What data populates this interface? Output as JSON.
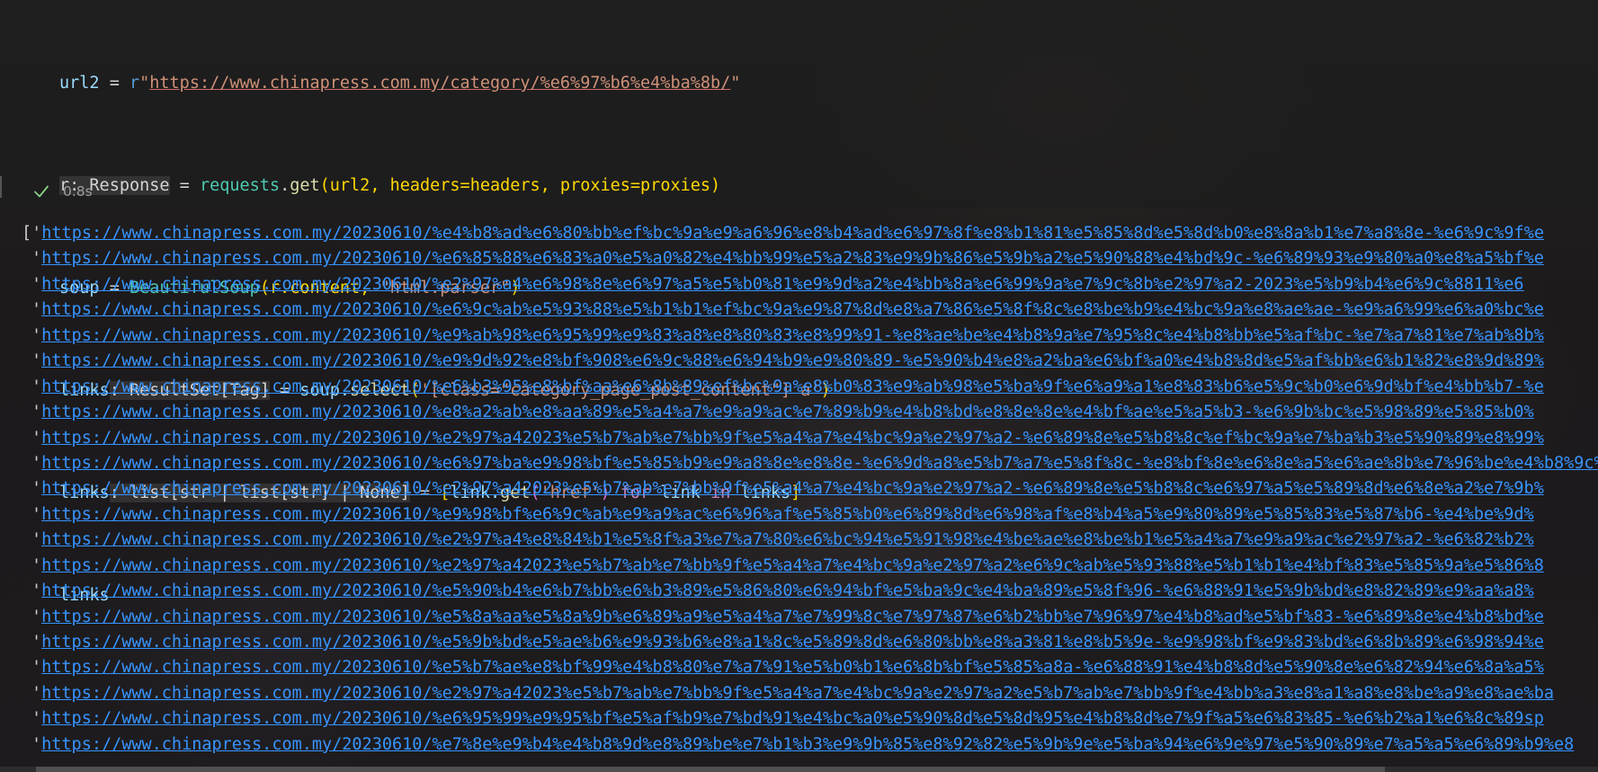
{
  "code_cell": {
    "lines": {
      "l1": {
        "var": "url2",
        "eq": " = ",
        "prefix": "r",
        "q1": "\"",
        "url": "https://www.chinapress.com.my/category/%e6%97%b6%e4%ba%8b/",
        "q2": "\""
      },
      "l2": {
        "hint": "r: Response",
        "eq": " = ",
        "mod": "requests",
        "dot": ".",
        "fn": "get",
        "args": "(url2, headers=headers, proxies=proxies)"
      },
      "l3": {
        "var": "soup",
        "eq": " = ",
        "cls": "BeautifulSoup",
        "open": "(r.content, ",
        "str": "\"html.parser\"",
        "close": ")"
      },
      "l4": {
        "var": "links",
        "hint": ": ResultSet[Tag]",
        "eq": " = ",
        "obj": "soup.",
        "fn": "select",
        "open": "(",
        "str": "'[class=\"category_page_post_content\"] a'",
        "close": ")"
      },
      "l5": {
        "var": "links",
        "hint": ": list[str | list[str] | None]",
        "eq": " = ",
        "lb": "[",
        "expr1": "link.",
        "fn": "get",
        "str_open": "(",
        "str": "'href'",
        "str_close": ")",
        "for_kw": " for ",
        "mid": "link",
        "in_kw": " in ",
        "end": "links",
        "rb": "]"
      },
      "l6": {
        "var": "links"
      }
    }
  },
  "status": {
    "duration": "0.8s"
  },
  "output": {
    "open_bracket": "[",
    "quote": "'",
    "links": [
      "https://www.chinapress.com.my/20230610/%e4%b8%ad%e6%80%bb%ef%bc%9a%e9%a6%96%e8%b4%ad%e6%97%8f%e8%b1%81%e5%85%8d%e5%8d%b0%e8%8a%b1%e7%a8%8e-%e6%9c%9f%e",
      "https://www.chinapress.com.my/20230610/%e6%85%88%e6%83%a0%e5%a0%82%e4%bb%99%e5%a2%83%e9%9b%86%e5%9b%a2%e5%90%88%e4%bd%9c-%e6%89%93%e9%80%a0%e8%a5%bf%e",
      "https://www.chinapress.com.my/20230610/%e2%97%a4%e6%98%8e%e6%97%a5%e5%b0%81%e9%9d%a2%e4%bb%8a%e6%99%9a%e7%9c%8b%e2%97%a2-2023%e5%b9%b4%e6%9c%8811%e6",
      "https://www.chinapress.com.my/20230610/%e6%9c%ab%e5%93%88%e5%b1%b1%ef%bc%9a%e9%87%8d%e8%a7%86%e5%8f%8c%e8%be%b9%e4%bc%9a%e8%ae%ae-%e9%a6%99%e6%a0%bc%e",
      "https://www.chinapress.com.my/20230610/%e9%ab%98%e6%95%99%e9%83%a8%e8%80%83%e8%99%91-%e8%ae%be%e4%b8%9a%e7%95%8c%e4%b8%bb%e5%af%bc-%e7%a7%81%e7%ab%8b%",
      "https://www.chinapress.com.my/20230610/%e9%9d%92%e8%bf%908%e6%9c%88%e6%94%b9%e9%80%89-%e5%90%b4%e8%a2%ba%e6%bf%a0%e4%b8%8d%e5%af%bb%e6%b1%82%e8%9d%89%",
      "https://www.chinapress.com.my/20230610/%e6%b3%95%e8%bf%aa%e6%8b%89%ef%bc%9a%e8%b0%83%e9%ab%98%e5%ba%9f%e6%a9%a1%e8%83%b6%e5%9c%b0%e6%9d%bf%e4%bb%b7-%e",
      "https://www.chinapress.com.my/20230610/%e8%a2%ab%e8%aa%89%e5%a4%a7%e9%a9%ac%e7%89%b9%e4%b8%bd%e8%8e%8e%e4%bf%ae%e5%a5%b3-%e6%9b%bc%e5%98%89%e5%85%b0%",
      "https://www.chinapress.com.my/20230610/%e2%97%a42023%e5%b7%ab%e7%bb%9f%e5%a4%a7%e4%bc%9a%e2%97%a2-%e6%89%8e%e5%b8%8c%ef%bc%9a%e7%ba%b3%e5%90%89%e8%99%",
      "https://www.chinapress.com.my/20230610/%e6%97%ba%e9%98%bf%e5%85%b9%e9%a8%8e%e8%8e-%e6%9d%a8%e5%b7%a7%e5%8f%8c-%e8%bf%8e%e6%8e%a5%e6%ae%8b%e7%96%be%e4%b8%9c%",
      "https://www.chinapress.com.my/20230610/%e2%97%a42023%e5%b7%ab%e7%bb%9f%e5%a4%a7%e4%bc%9a%e2%97%a2-%e6%89%8e%e5%b8%8c%e6%97%a5%e5%89%8d%e6%8e%a2%e7%9b%",
      "https://www.chinapress.com.my/20230610/%e9%98%bf%e6%9c%ab%e9%a9%ac%e6%96%af%e5%85%b0%e6%89%8d%e6%98%af%e8%b4%a5%e9%80%89%e5%85%83%e5%87%b6-%e4%be%9d%",
      "https://www.chinapress.com.my/20230610/%e2%97%a4%e8%84%b1%e5%8f%a3%e7%a7%80%e6%bc%94%e5%91%98%e4%be%ae%e8%be%b1%e5%a4%a7%e9%a9%ac%e2%97%a2-%e6%82%b2%",
      "https://www.chinapress.com.my/20230610/%e2%97%a42023%e5%b7%ab%e7%bb%9f%e5%a4%a7%e4%bc%9a%e2%97%a2%e6%9c%ab%e5%93%88%e5%b1%b1%e4%bf%83%e5%85%9a%e5%86%8",
      "https://www.chinapress.com.my/20230610/%e5%90%b4%e6%b7%bb%e6%b3%89%e5%86%80%e6%94%bf%e5%ba%9c%e4%ba%89%e5%8f%96-%e6%88%91%e5%9b%bd%e8%82%89%e9%aa%a8%",
      "https://www.chinapress.com.my/20230610/%e5%8a%aa%e5%8a%9b%e6%89%a9%e5%a4%a7%e7%99%8c%e7%97%87%e6%b2%bb%e7%96%97%e4%b8%ad%e5%bf%83-%e6%89%8e%e4%b8%bd%e",
      "https://www.chinapress.com.my/20230610/%e5%9b%bd%e5%ae%b6%e9%93%b6%e8%a1%8c%e5%89%8d%e6%80%bb%e8%a3%81%e8%b5%9e-%e9%98%bf%e9%83%bd%e6%8b%89%e6%98%94%e",
      "https://www.chinapress.com.my/20230610/%e5%b7%ae%e8%bf%99%e4%b8%80%e7%a7%91%e5%b0%b1%e6%8b%bf%e5%85%a8a-%e6%88%91%e4%b8%8d%e5%90%8e%e6%82%94%e6%8a%a5%",
      "https://www.chinapress.com.my/20230610/%e2%97%a42023%e5%b7%ab%e7%bb%9f%e5%a4%a7%e4%bc%9a%e2%97%a2%e5%b7%ab%e7%bb%9f%e4%bb%a3%e8%a1%a8%e8%be%a9%e8%ae%ba",
      "https://www.chinapress.com.my/20230610/%e6%95%99%e9%95%bf%e5%af%b9%e7%bd%91%e4%bc%a0%e5%90%8d%e5%8d%95%e4%b8%8d%e7%9f%a5%e6%83%85-%e6%b2%a1%e6%8c%89sp",
      "https://www.chinapress.com.my/20230610/%e7%8e%e9%b4%e4%b8%9d%e8%89%be%e7%b1%b3%e9%9b%85%e8%92%82%e5%9b%9e%e5%ba%94%e6%9e%97%e5%90%89%e7%a5%a5%e6%89%b9%e8"
    ]
  }
}
